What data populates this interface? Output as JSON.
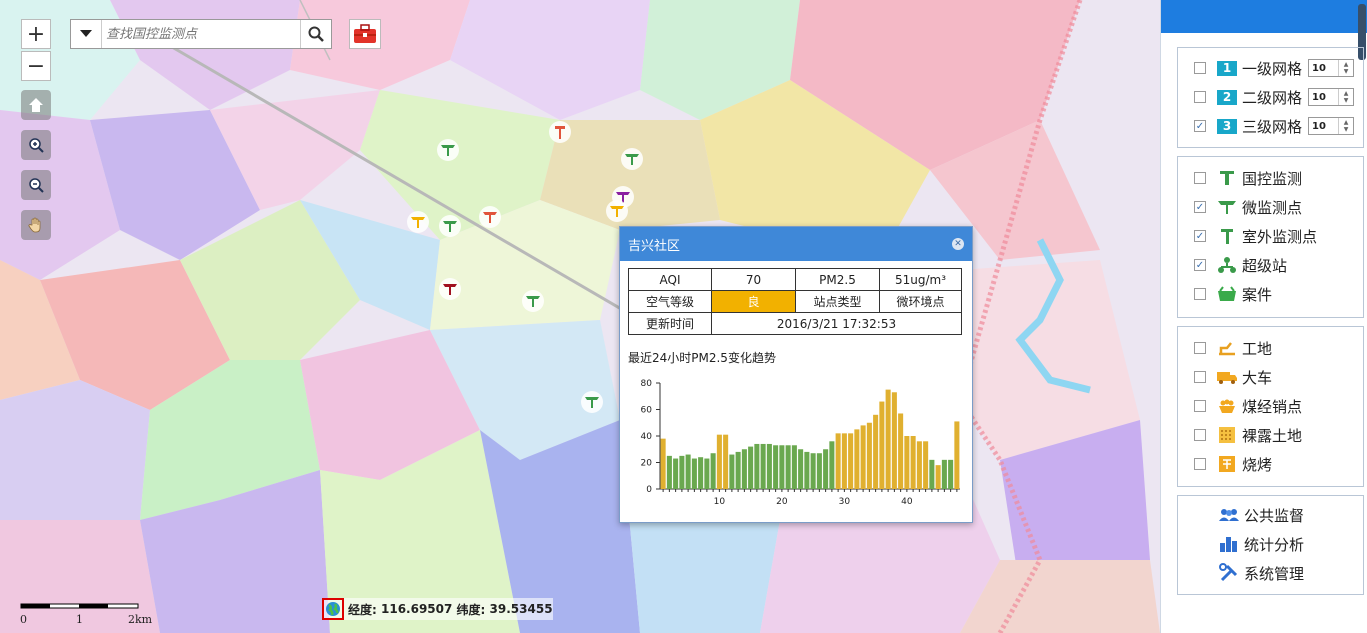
{
  "search": {
    "placeholder": "查找国控监测点"
  },
  "map_controls": {
    "zoom_in": "+",
    "zoom_out": "−"
  },
  "popup": {
    "title": "吉兴社区",
    "table": {
      "aqi_label": "AQI",
      "aqi_value": "70",
      "pm_label": "PM2.5",
      "pm_value": "51ug/m³",
      "level_label": "空气等级",
      "level_value": "良",
      "type_label": "站点类型",
      "type_value": "微环境点",
      "time_label": "更新时间",
      "time_value": "2016/3/21 17:32:53"
    },
    "trend_title": "最近24小时PM2.5变化趋势",
    "colors": {
      "good": "#f2b100",
      "green_bar": "#6aa84f",
      "yellow_bar": "#e0b030"
    }
  },
  "chart_data": {
    "type": "bar",
    "title": "",
    "x": [
      1,
      2,
      3,
      4,
      5,
      6,
      7,
      8,
      9,
      10,
      11,
      12,
      13,
      14,
      15,
      16,
      17,
      18,
      19,
      20,
      21,
      22,
      23,
      24,
      25,
      26,
      27,
      28,
      29,
      30,
      31,
      32,
      33,
      34,
      35,
      36,
      37,
      38,
      39,
      40,
      41,
      42,
      43,
      44,
      45,
      46,
      47,
      48
    ],
    "values": [
      38,
      25,
      23,
      25,
      26,
      23,
      24,
      23,
      27,
      41,
      41,
      26,
      28,
      30,
      32,
      34,
      34,
      34,
      33,
      33,
      33,
      33,
      30,
      28,
      27,
      27,
      30,
      36,
      42,
      42,
      42,
      45,
      48,
      50,
      56,
      66,
      75,
      73,
      57,
      40,
      40,
      36,
      36,
      22,
      18,
      22,
      22,
      51
    ],
    "colors": [
      "y",
      "g",
      "g",
      "g",
      "g",
      "g",
      "g",
      "g",
      "g",
      "y",
      "y",
      "g",
      "g",
      "g",
      "g",
      "g",
      "g",
      "g",
      "g",
      "g",
      "g",
      "g",
      "g",
      "g",
      "g",
      "g",
      "g",
      "g",
      "y",
      "y",
      "y",
      "y",
      "y",
      "y",
      "y",
      "y",
      "y",
      "y",
      "y",
      "y",
      "y",
      "y",
      "y",
      "g",
      "y",
      "g",
      "g",
      "y"
    ],
    "x_ticks": [
      10,
      20,
      30,
      40
    ],
    "ylim": [
      0,
      80
    ],
    "y_ticks": [
      0,
      20,
      40,
      60,
      80
    ]
  },
  "coords": {
    "lon_label": "经度:",
    "lon": "116.69507",
    "lat_label": "纬度:",
    "lat": "39.53455"
  },
  "scale": {
    "t0": "0",
    "t1": "1",
    "t2": "2km"
  },
  "panel": {
    "grid": [
      {
        "badge": "1",
        "label": "一级网格",
        "value": "10",
        "checked": false
      },
      {
        "badge": "2",
        "label": "二级网格",
        "value": "10",
        "checked": false
      },
      {
        "badge": "3",
        "label": "三级网格",
        "value": "10",
        "checked": true
      }
    ],
    "stations": [
      {
        "label": "国控监测",
        "checked": false
      },
      {
        "label": "微监测点",
        "checked": true
      },
      {
        "label": "室外监测点",
        "checked": true
      },
      {
        "label": "超级站",
        "checked": true
      },
      {
        "label": "案件",
        "checked": false
      }
    ],
    "sources": [
      {
        "label": "工地",
        "checked": false
      },
      {
        "label": "大车",
        "checked": false
      },
      {
        "label": "煤经销点",
        "checked": false
      },
      {
        "label": "裸露土地",
        "checked": false
      },
      {
        "label": "烧烤",
        "checked": false
      }
    ],
    "links": [
      {
        "label": "公共监督"
      },
      {
        "label": "统计分析"
      },
      {
        "label": "系统管理"
      }
    ]
  }
}
